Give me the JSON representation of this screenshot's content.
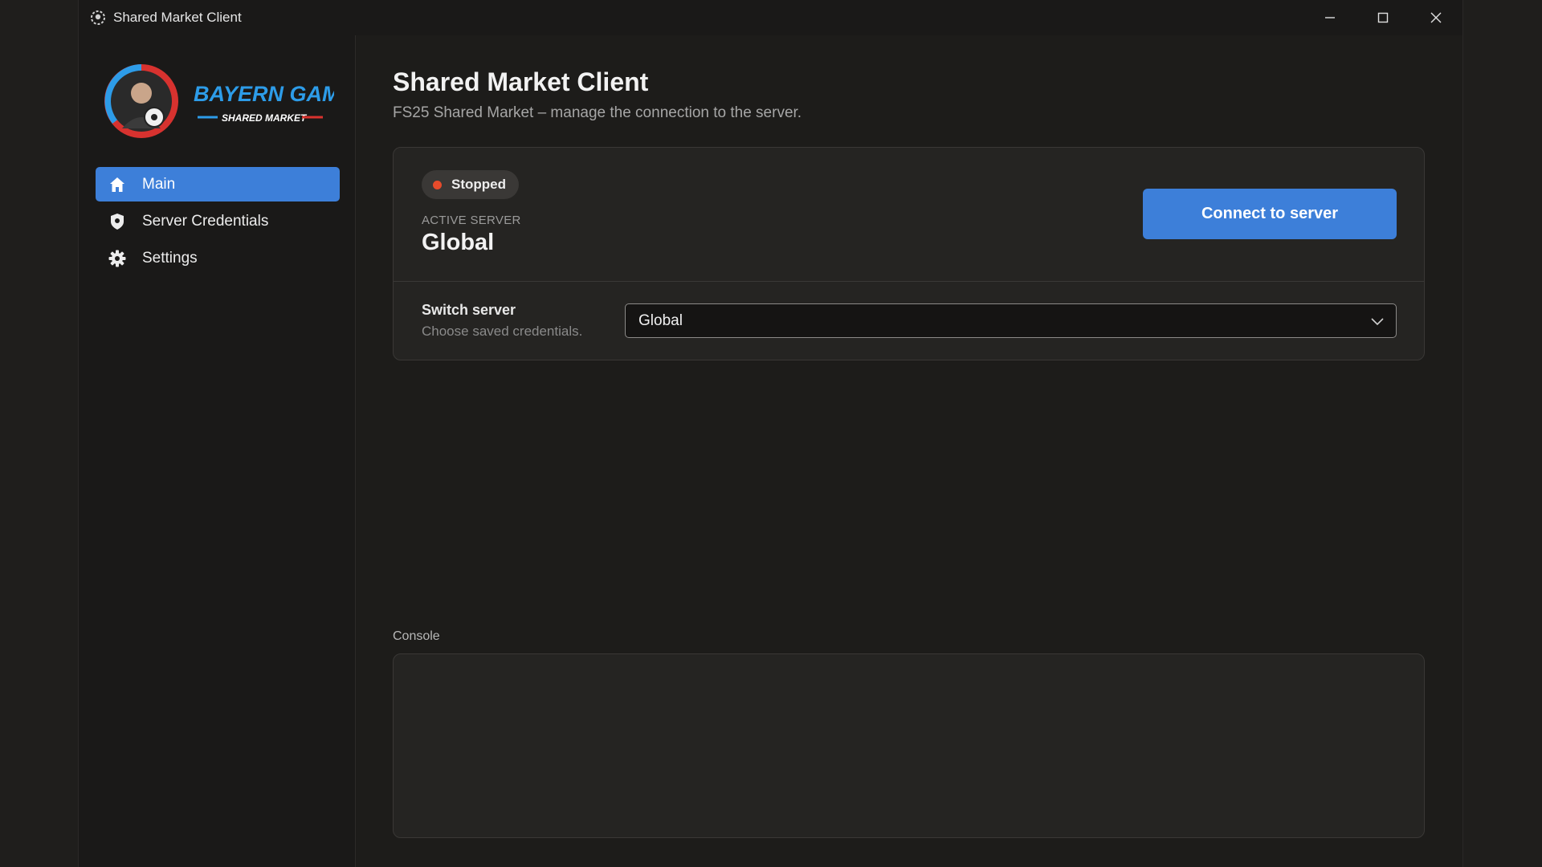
{
  "window": {
    "title": "Shared Market Client",
    "controls": [
      "minimize-icon",
      "maximize-icon",
      "close-icon"
    ]
  },
  "sidebar": {
    "logo": {
      "line1": "BAYERN GAMERS",
      "line2": "SHARED MARKET"
    },
    "items": [
      {
        "label": "Main",
        "icon": "home-icon",
        "active": true
      },
      {
        "label": "Server Credentials",
        "icon": "shield-icon",
        "active": false
      },
      {
        "label": "Settings",
        "icon": "gear-icon",
        "active": false
      }
    ]
  },
  "main": {
    "title": "Shared Market Client",
    "subtitle": "FS25 Shared Market – manage the connection to the server.",
    "status": {
      "label": "Stopped",
      "color": "#e74b2b"
    },
    "active_server_label": "ACTIVE SERVER",
    "active_server_value": "Global",
    "connect_button": "Connect to server",
    "switch_label": "Switch server",
    "switch_hint": "Choose saved credentials.",
    "switch_selected": "Global",
    "console_label": "Console"
  },
  "colors": {
    "accent": "#3d7fd9",
    "status_stopped": "#e74b2b",
    "logo_blue": "#2d9ce8",
    "logo_red": "#d9322e"
  }
}
